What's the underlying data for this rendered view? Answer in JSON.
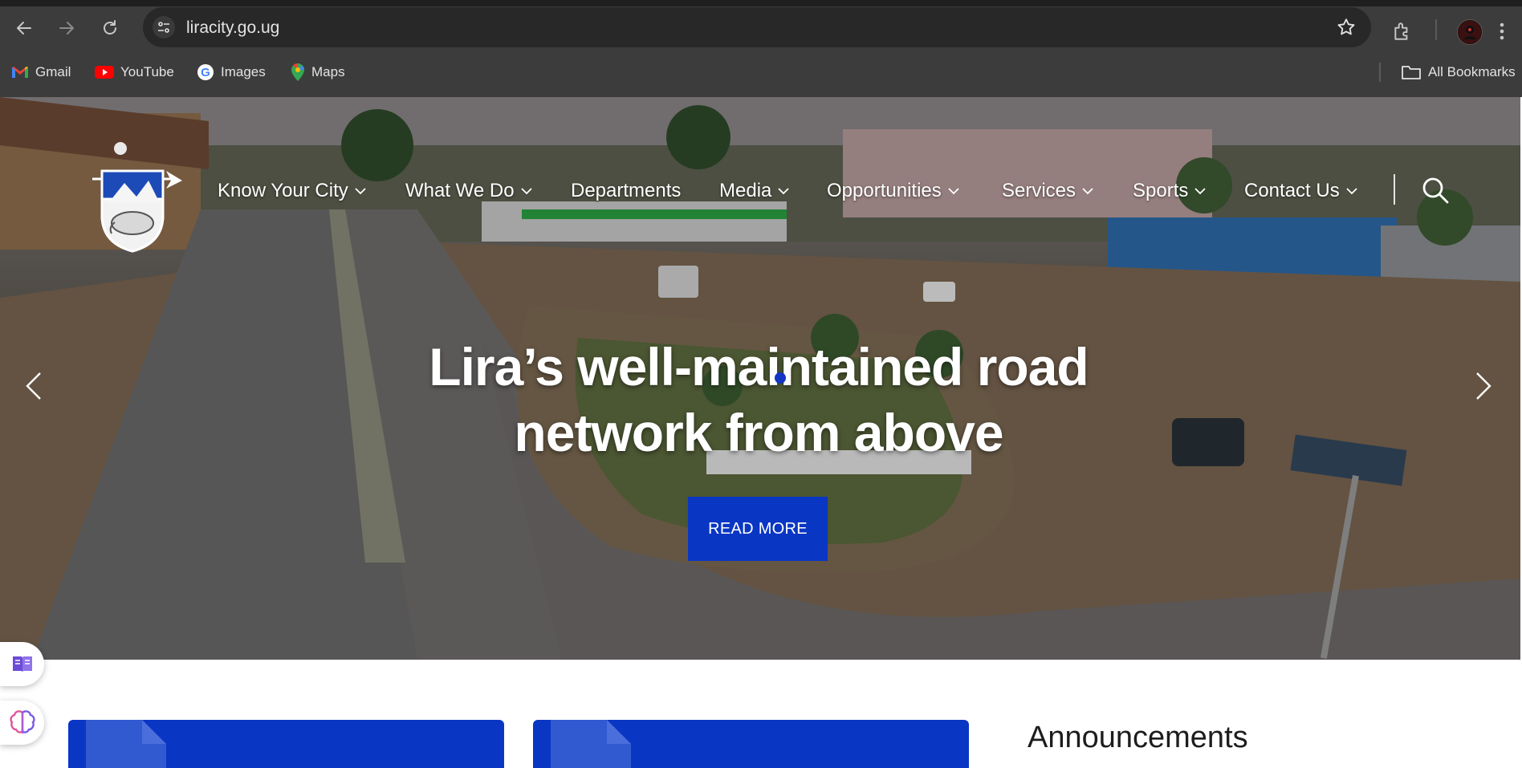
{
  "browser": {
    "url": "liracity.go.ug",
    "bookmarks": [
      {
        "label": "Gmail",
        "icon": "gmail-icon"
      },
      {
        "label": "YouTube",
        "icon": "youtube-icon"
      },
      {
        "label": "Images",
        "icon": "google-icon"
      },
      {
        "label": "Maps",
        "icon": "maps-icon"
      }
    ],
    "all_bookmarks_label": "All Bookmarks"
  },
  "nav": {
    "items": [
      {
        "label": "Know Your City",
        "dropdown": true
      },
      {
        "label": "What We Do",
        "dropdown": true
      },
      {
        "label": "Departments",
        "dropdown": false
      },
      {
        "label": "Media",
        "dropdown": true
      },
      {
        "label": "Opportunities",
        "dropdown": true
      },
      {
        "label": "Services",
        "dropdown": true
      },
      {
        "label": "Sports",
        "dropdown": true
      },
      {
        "label": "Contact Us",
        "dropdown": true
      }
    ]
  },
  "hero": {
    "headline_line1": "Lira’s well-maintained road",
    "headline_line2": "network from above",
    "button_label": "READ MORE"
  },
  "sections": {
    "announcements_title": "Announcements"
  },
  "colors": {
    "brand_blue": "#0a36c4",
    "chrome_bg": "#3c3c3c",
    "omnibox_bg": "#282828"
  }
}
